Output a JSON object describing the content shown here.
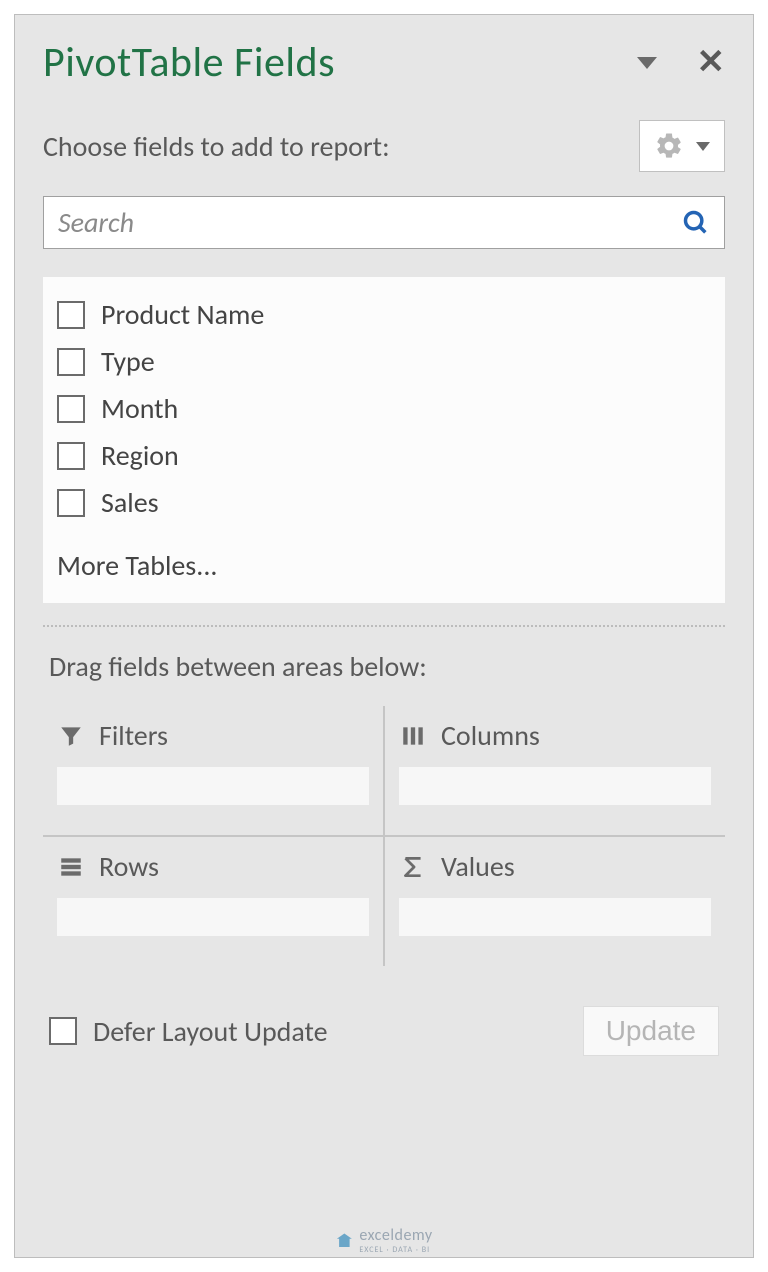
{
  "header": {
    "title": "PivotTable Fields"
  },
  "subtitle": "Choose fields to add to report:",
  "search": {
    "placeholder": "Search"
  },
  "fields": [
    {
      "label": "Product Name"
    },
    {
      "label": "Type"
    },
    {
      "label": "Month"
    },
    {
      "label": "Region"
    },
    {
      "label": "Sales"
    }
  ],
  "more_tables": "More Tables...",
  "drag_label": "Drag fields between areas below:",
  "areas": {
    "filters": "Filters",
    "columns": "Columns",
    "rows": "Rows",
    "values": "Values"
  },
  "footer": {
    "defer_label": "Defer Layout Update",
    "update_label": "Update"
  },
  "watermark": {
    "brand": "exceldemy",
    "tagline": "EXCEL · DATA · BI"
  }
}
